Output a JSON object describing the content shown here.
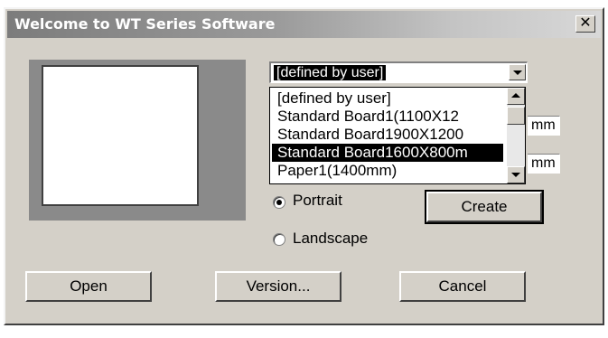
{
  "window": {
    "title": "Welcome to WT Series Software",
    "close_glyph": "✕"
  },
  "board_select": {
    "selected_value": "[defined by user]",
    "options": [
      "[defined by user]",
      "Standard Board1(1100X12",
      "Standard Board1900X1200",
      "Standard Board1600X800m",
      "Paper1(1400mm)"
    ],
    "highlighted_index": 3
  },
  "units": {
    "width_unit": "mm",
    "height_unit": "mm"
  },
  "orientation": {
    "portrait_label": "Portrait",
    "landscape_label": "Landscape",
    "selected": "Portrait"
  },
  "buttons": {
    "create": "Create",
    "open": "Open",
    "version": "Version...",
    "cancel": "Cancel"
  },
  "icons": {
    "combo_arrow": "chevron-down-icon",
    "scroll_up": "scroll-up-arrow-icon",
    "scroll_down": "scroll-down-arrow-icon"
  }
}
